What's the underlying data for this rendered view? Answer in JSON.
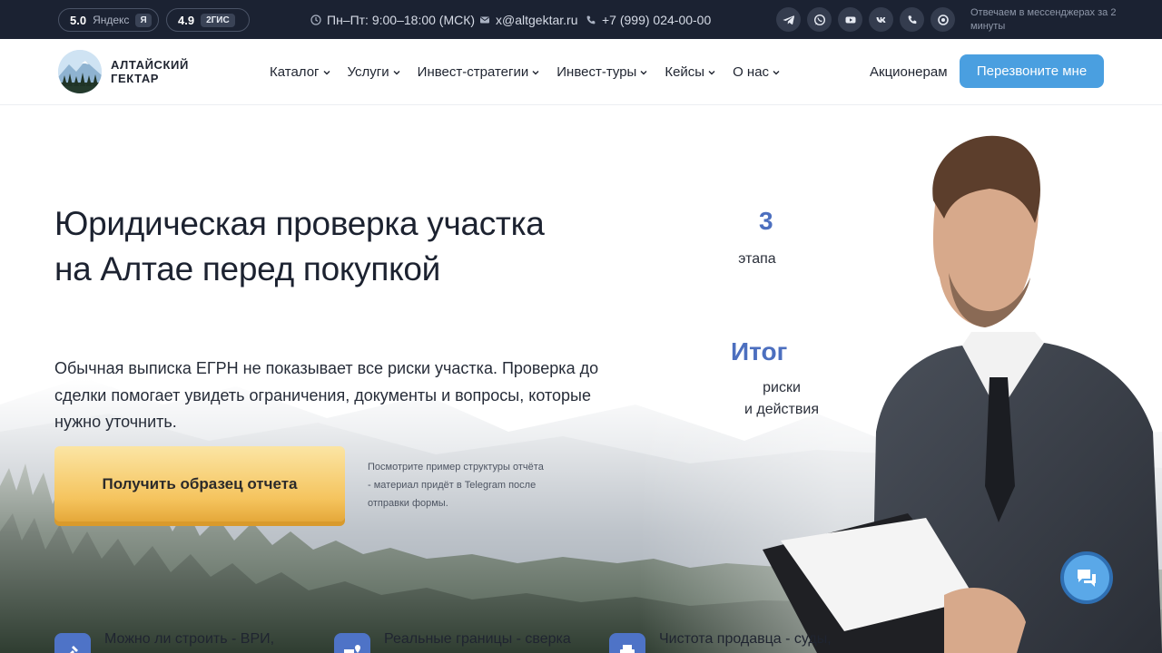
{
  "topbar": {
    "ratings": [
      {
        "score": "5.0",
        "label": "Яндекс",
        "badge": "Я"
      },
      {
        "score": "4.9",
        "badge": "2ГИС"
      }
    ],
    "hours": "Пн–Пт: 9:00–18:00 (МСК)",
    "email": "x@altgektar.ru",
    "phone": "+7 (999) 024-00-00",
    "social_icons": [
      "telegram-icon",
      "whatsapp-icon",
      "youtube-icon",
      "vk-icon",
      "phone-icon",
      "max-icon"
    ],
    "note": "Отвечаем в мессенджерах за 2 минуты"
  },
  "header": {
    "logo_text_line1": "АЛТАЙСКИЙ",
    "logo_text_line2": "ГЕКТАР",
    "nav": [
      "Каталог",
      "Услуги",
      "Инвест-стратегии",
      "Инвест-туры",
      "Кейсы",
      "О нас"
    ],
    "shareholders_link": "Акционерам",
    "callback_button": "Перезвоните мне"
  },
  "hero": {
    "title_line1": "Юридическая проверка участка",
    "title_line2": "на Алтае перед покупкой",
    "description": "Обычная выписка ЕГРН не показывает все риски участка. Проверка до сделки помогает увидеть ограничения, документы и вопросы, которые нужно уточнить.",
    "sample_button": "Получить образец отчета",
    "sample_note": "Посмотрите пример структуры отчёта - материал придёт в Telegram после отправки формы.",
    "stats": [
      {
        "value": "3",
        "label": "этапа"
      },
      {
        "value": "Итог",
        "label_line1": "риски",
        "label_line2": "и действия"
      }
    ],
    "features": [
      {
        "text": "Можно ли строить - ВРИ,",
        "icon": "build-icon"
      },
      {
        "text": "Реальные границы - сверка",
        "icon": "truck-location-icon"
      },
      {
        "text": "Чистота продавца - суды,",
        "icon": "printer-icon"
      }
    ]
  },
  "colors": {
    "topbar_bg": "#1b2232",
    "accent_blue": "#4a9fe0",
    "stat_blue": "#4c6fbf",
    "cta_gold": "#f5c45e"
  }
}
